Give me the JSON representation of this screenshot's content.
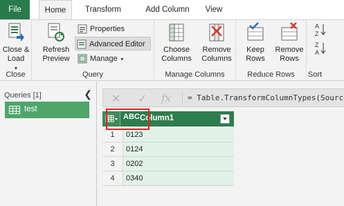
{
  "tabs": [
    "File",
    "Home",
    "Transform",
    "Add Column",
    "View"
  ],
  "ribbon": {
    "close_group": {
      "button_label": "Close &\nLoad",
      "label": "Close"
    },
    "query_group": {
      "refresh_label": "Refresh\nPreview",
      "properties_label": "Properties",
      "advanced_editor_label": "Advanced Editor",
      "manage_label": "Manage",
      "label": "Query"
    },
    "manage_columns_group": {
      "choose_label": "Choose\nColumns",
      "remove_label": "Remove\nColumns",
      "label": "Manage Columns"
    },
    "reduce_rows_group": {
      "keep_label": "Keep\nRows",
      "remove_label": "Remove\nRows",
      "label": "Reduce Rows"
    },
    "sort_group": {
      "label": "Sort"
    }
  },
  "queries": {
    "title": "Queries [1]",
    "items": [
      {
        "label": "test"
      }
    ]
  },
  "formula_bar": {
    "fx_symbol": "fx",
    "formula": "= Table.TransformColumnTypes(Source"
  },
  "grid": {
    "type_indicator": "ABC",
    "column_header": "Column1",
    "rows": [
      {
        "num": "1",
        "value": "0123"
      },
      {
        "num": "2",
        "value": "0124"
      },
      {
        "num": "3",
        "value": "0202"
      },
      {
        "num": "4",
        "value": "0340"
      }
    ]
  },
  "colors": {
    "accent_green": "#2b7a4b",
    "header_green": "#2e7d4c",
    "cell_green": "#e3f2e9",
    "highlight_red": "#e02020"
  }
}
